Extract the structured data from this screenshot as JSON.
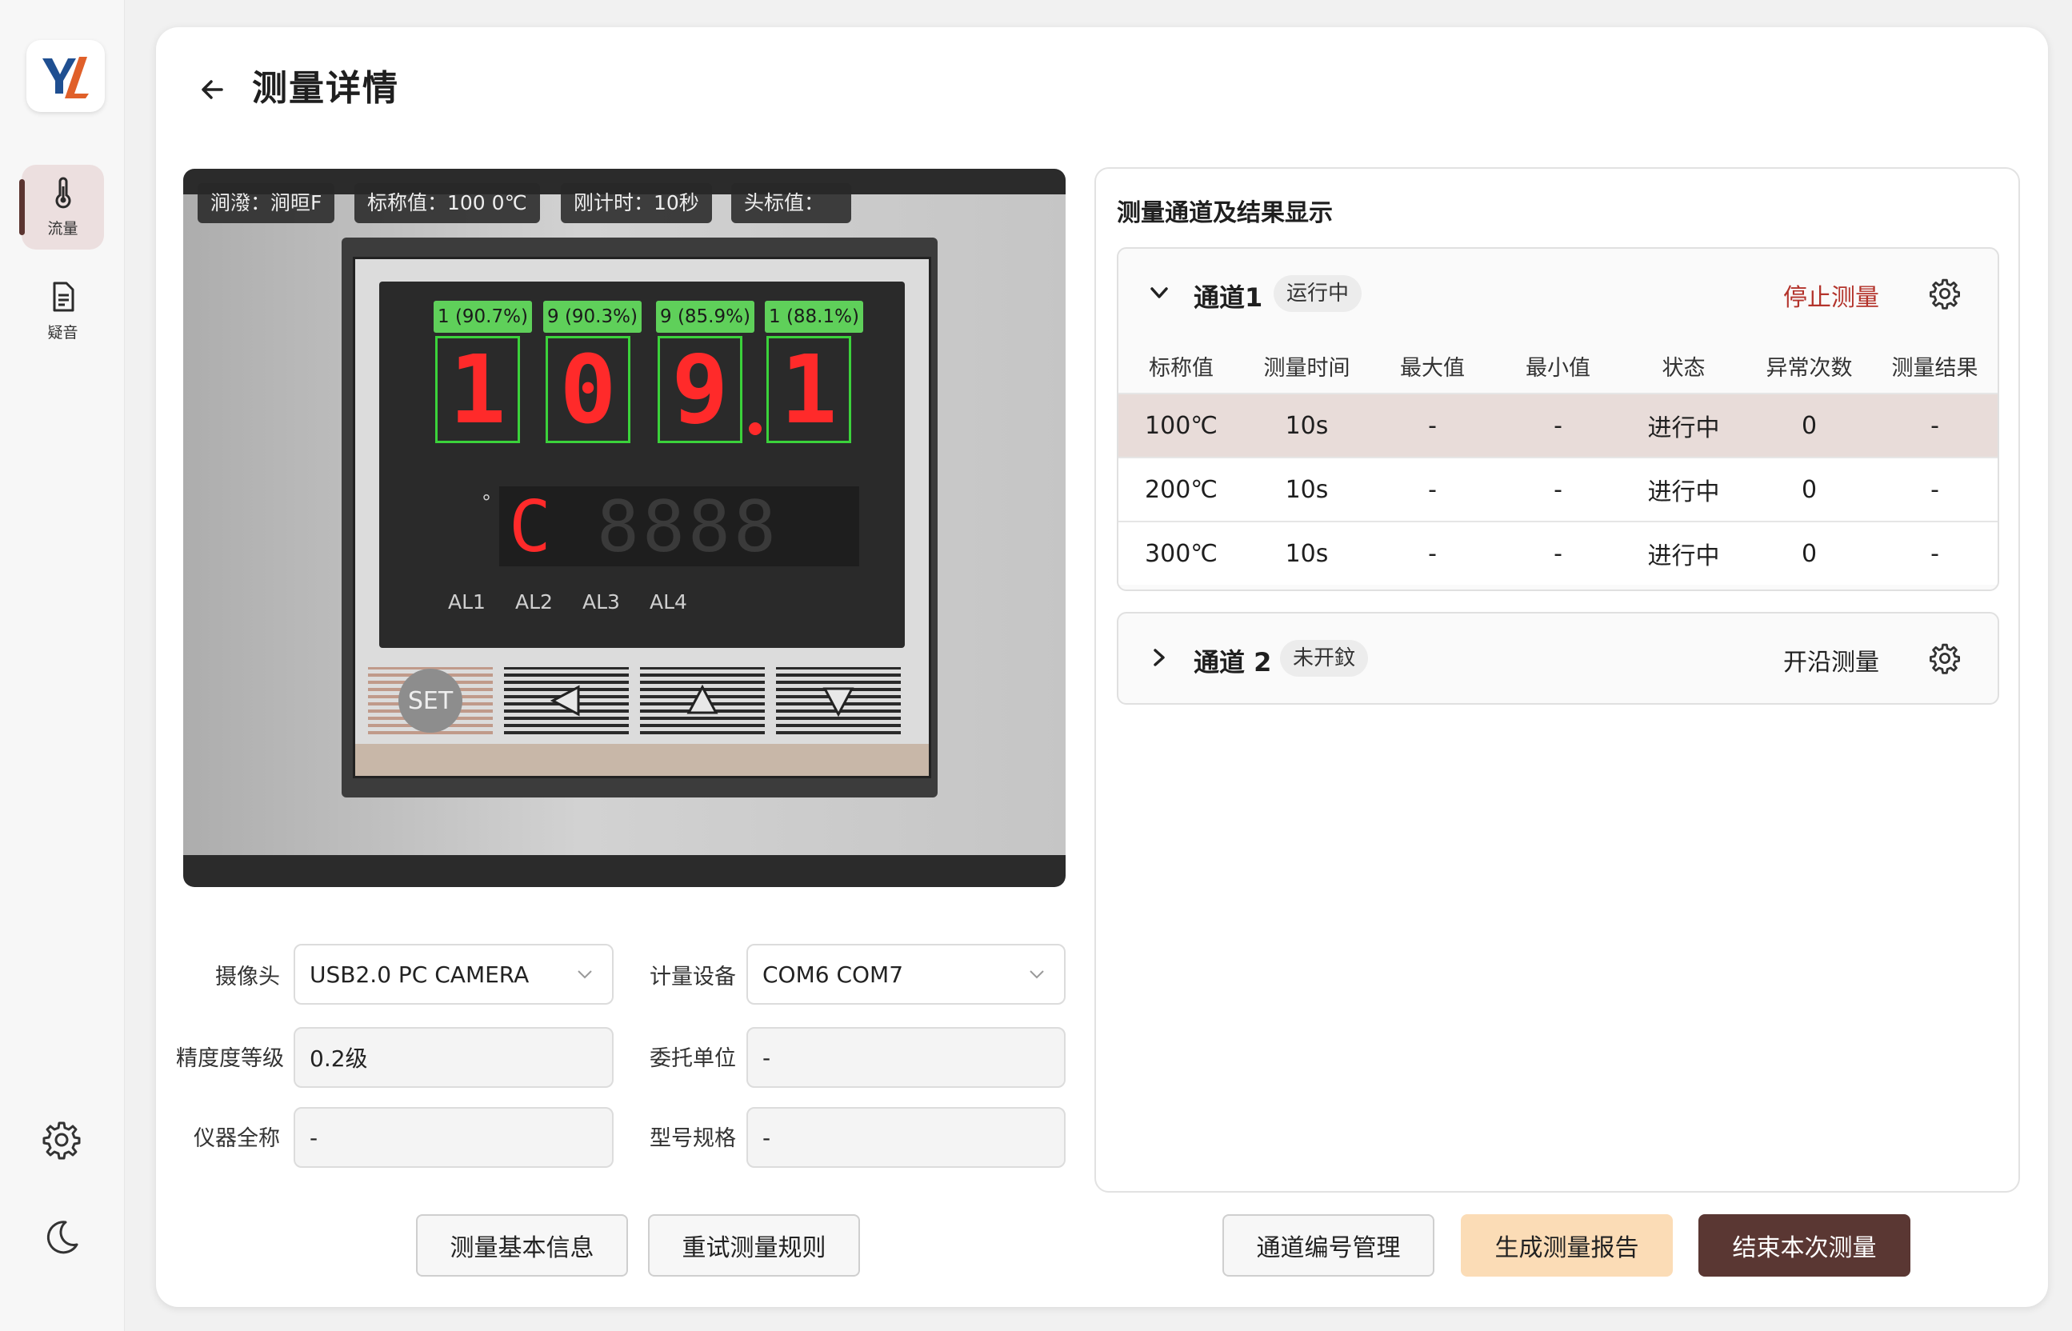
{
  "sidebar": {
    "logo_text": "YL",
    "items": [
      {
        "label": "流量",
        "icon": "thermometer-icon",
        "active": true
      },
      {
        "label": "疑音",
        "icon": "document-icon",
        "active": false
      }
    ],
    "bottom_icons": [
      "gear-icon",
      "moon-icon"
    ]
  },
  "header": {
    "title": "测量详情"
  },
  "camera": {
    "chips": [
      "涧潑：涧晅F",
      "标称值：100 0℃",
      "刚计时：10秒",
      "头标值："
    ],
    "digit_labels": [
      "1 (90.7%)",
      "9 (90.3%)",
      "9 (85.9%)",
      "1 (88.1%)"
    ],
    "digits": [
      "1",
      "0",
      "9",
      "1"
    ],
    "sub_unit": "C",
    "sub_ghost": "8888",
    "deg_mark": "°",
    "alarms": [
      "AL1",
      "AL2",
      "AL3",
      "AL4"
    ],
    "set_key": "SET"
  },
  "form": {
    "camera_label": "摄像头",
    "camera_value": "USB2.0 PC CAMERA",
    "device_label": "计量设备",
    "device_value": "COM6 COM7",
    "accuracy_label": "精度度等级",
    "accuracy_value": "0.2级",
    "client_label": "委托单位",
    "client_value": "-",
    "instrument_label": "仪器全称",
    "instrument_value": "-",
    "model_label": "型号规格",
    "model_value": "-"
  },
  "buttons": {
    "basic_info": "测量基本信息",
    "retry_rules": "重试测量规则",
    "channel_manage": "通道编号管理",
    "gen_report": "生成测量报告",
    "end_measure": "结束本次测量"
  },
  "results": {
    "title": "测量通道及结果显示",
    "columns": [
      "标称值",
      "测量时间",
      "最大值",
      "最小值",
      "状态",
      "异常次数",
      "测量结果"
    ],
    "channels": [
      {
        "name": "通道1",
        "status": "运行中",
        "action": "停止测量",
        "expanded": true,
        "rows": [
          [
            "100℃",
            "10s",
            "-",
            "-",
            "进行中",
            "0",
            "-"
          ],
          [
            "200℃",
            "10s",
            "-",
            "-",
            "进行中",
            "0",
            "-"
          ],
          [
            "300℃",
            "10s",
            "-",
            "-",
            "进行中",
            "0",
            "-"
          ]
        ]
      },
      {
        "name": "通道 2",
        "status": "未开鈫",
        "action": "开沿测量",
        "expanded": false
      }
    ]
  },
  "colors": {
    "accent_dark": "#5a3733",
    "accent_light": "#fbdcb6",
    "stop_red": "#b3332b",
    "lcd_red": "#ff2a2a",
    "detect_green": "#3bd23b",
    "active_nav": "#ecdfdf"
  }
}
